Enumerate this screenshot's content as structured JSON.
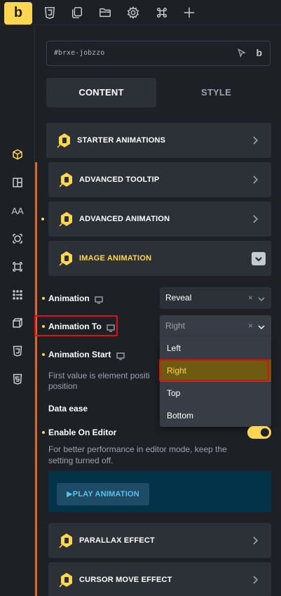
{
  "topbar": {
    "logo": "b",
    "icons": [
      "css3-icon",
      "pages-icon",
      "folder-icon",
      "settings-icon",
      "command-icon",
      "add-icon"
    ]
  },
  "sidebar": {
    "items": [
      {
        "icon": "box-icon",
        "active": true
      },
      {
        "icon": "layout-icon",
        "active": false
      },
      {
        "icon": "typography-icon",
        "label": "AA",
        "active": false
      },
      {
        "icon": "component-icon",
        "active": false
      },
      {
        "icon": "frame-icon",
        "active": false
      },
      {
        "icon": "grid-dots-icon",
        "active": false
      },
      {
        "icon": "cube-icon",
        "active": false
      },
      {
        "icon": "css3-icon",
        "active": false
      },
      {
        "icon": "html5-icon",
        "active": false
      }
    ]
  },
  "element": {
    "id": "#brxe-jobzzo",
    "suffix": "b"
  },
  "tabs": [
    {
      "label": "CONTENT",
      "active": true
    },
    {
      "label": "STYLE",
      "active": false
    }
  ],
  "sections": [
    {
      "label": "STARTER ANIMATIONS",
      "open": false,
      "dot": false
    },
    {
      "label": "ADVANCED TOOLTIP",
      "open": false,
      "dot": false
    },
    {
      "label": "ADVANCED ANIMATION",
      "open": false,
      "dot": true
    },
    {
      "label": "IMAGE ANIMATION",
      "open": true,
      "dot": false
    },
    {
      "label": "PARALLAX EFFECT",
      "open": false,
      "dot": false
    },
    {
      "label": "CURSOR MOVE EFFECT",
      "open": false,
      "dot": false
    }
  ],
  "controls": {
    "animation": {
      "label": "Animation",
      "value": "Reveal"
    },
    "animation_to": {
      "label": "Animation To",
      "value": "Right",
      "options": [
        "Left",
        "Right",
        "Top",
        "Bottom"
      ],
      "selected_index": 1
    },
    "animation_start": {
      "label": "Animation Start",
      "desc_line1": "First value is element positi",
      "desc_line2": "position"
    },
    "data_ease": {
      "label": "Data ease"
    },
    "enable_on_editor": {
      "label": "Enable On Editor",
      "value": true,
      "desc_line1": "For better performance in editor mode, keep the",
      "desc_line2": "setting turned off."
    },
    "play": {
      "label": "▶PLAY ANIMATION"
    }
  },
  "colors": {
    "accent": "#ffd64f",
    "section_accent": "#e0622b",
    "highlight": "#e01010",
    "panel": "#2c3138",
    "background": "#1d2025"
  }
}
